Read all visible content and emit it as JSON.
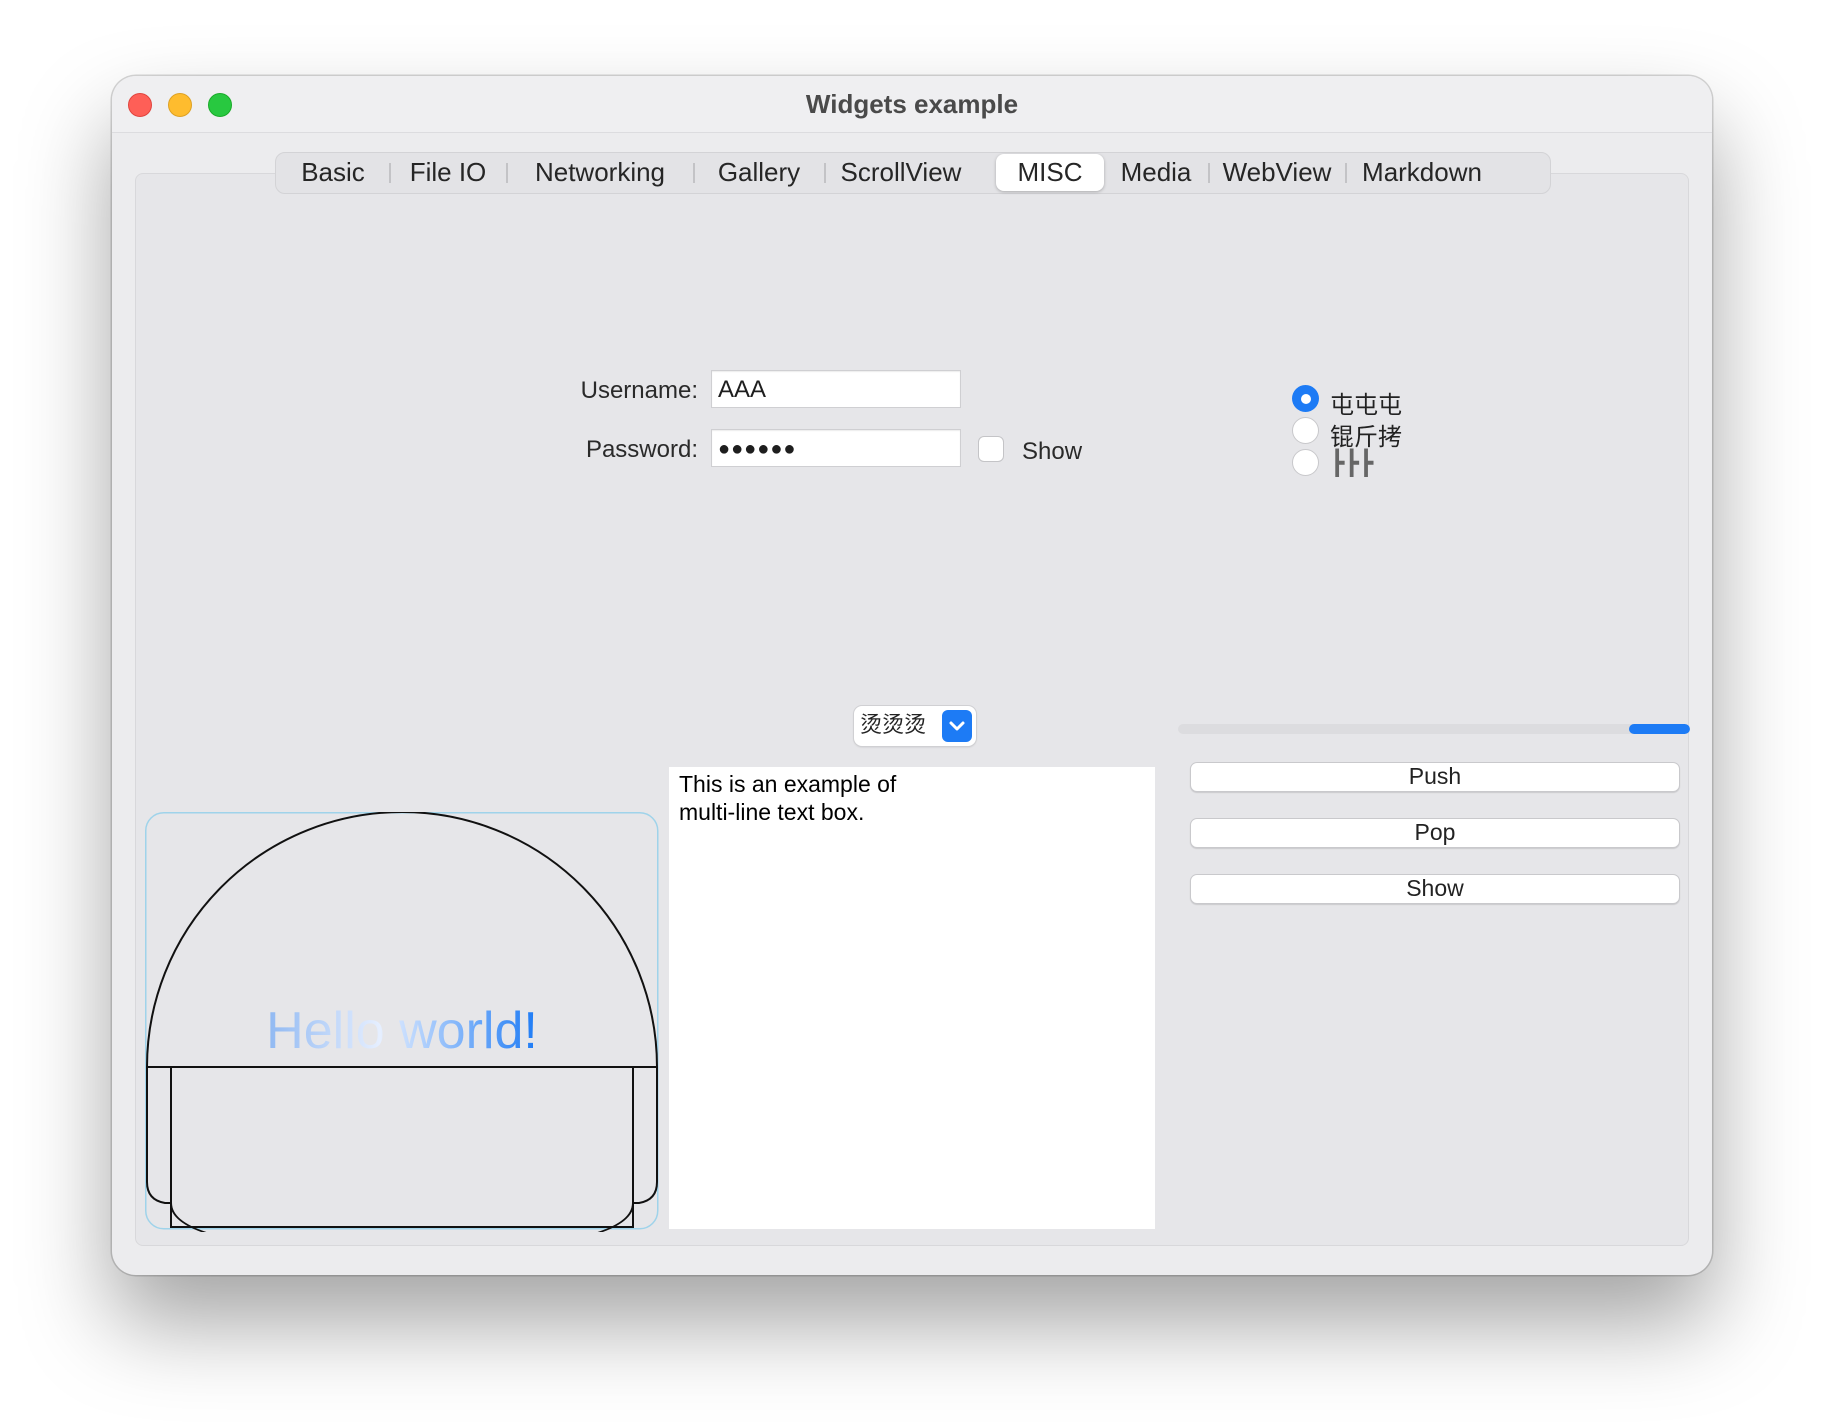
{
  "window": {
    "title": "Widgets example"
  },
  "tabs": [
    {
      "label": "Basic",
      "active": false
    },
    {
      "label": "File IO",
      "active": false
    },
    {
      "label": "Networking",
      "active": false
    },
    {
      "label": "Gallery",
      "active": false
    },
    {
      "label": "ScrollView",
      "active": false
    },
    {
      "label": "MISC",
      "active": true
    },
    {
      "label": "Media",
      "active": false
    },
    {
      "label": "WebView",
      "active": false
    },
    {
      "label": "Markdown",
      "active": false
    }
  ],
  "login": {
    "username_label": "Username:",
    "username_value": "AAA",
    "password_label": "Password:",
    "password_masked": "●●●●●●",
    "show_label": "Show",
    "show_checked": false
  },
  "radios": [
    {
      "label": "屯屯屯",
      "checked": true
    },
    {
      "label": "锟斤拷",
      "checked": false
    },
    {
      "label": "┣┣┣",
      "checked": false
    }
  ],
  "canvas": {
    "text": "Hello world!"
  },
  "combo": {
    "value": "烫烫烫"
  },
  "textbox": {
    "text": "This is an example of\nmulti-line text box."
  },
  "slider": {
    "value": 0.12
  },
  "buttons": {
    "push": "Push",
    "pop": "Pop",
    "show": "Show"
  },
  "colors": {
    "accent": "#1d7bf5",
    "gradient_start": "#a8c8f5",
    "gradient_end": "#1d7bf5"
  },
  "icons": {
    "combo_arrow": "chevron-down-icon"
  }
}
